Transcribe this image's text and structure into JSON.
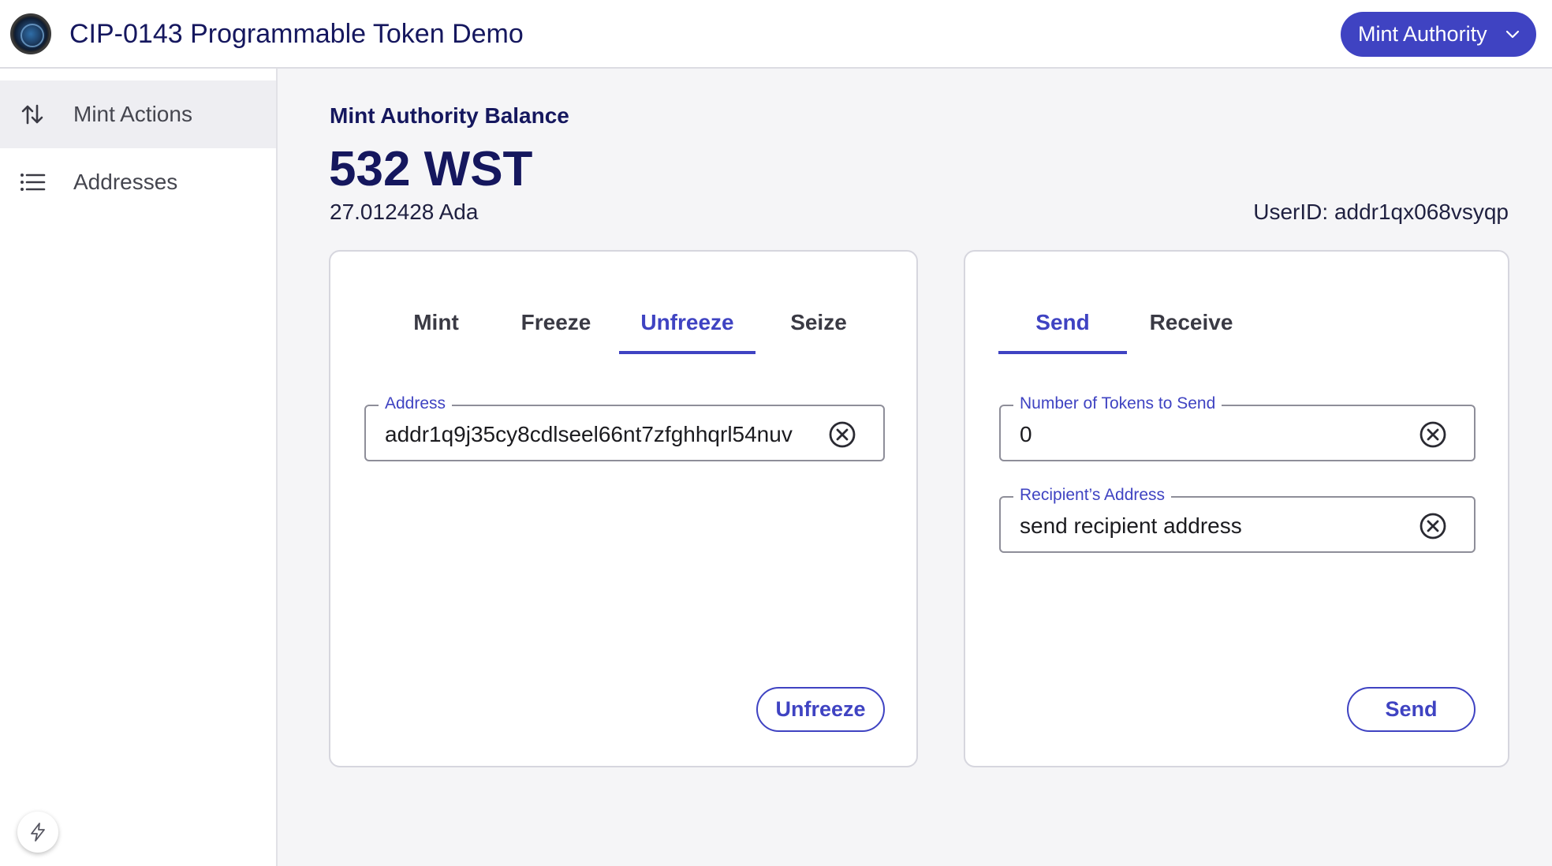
{
  "header": {
    "title": "CIP-0143 Programmable Token Demo",
    "role_selector": "Mint Authority"
  },
  "sidebar": {
    "items": [
      {
        "label": "Mint Actions",
        "icon": "swap-vertical-icon",
        "active": true
      },
      {
        "label": "Addresses",
        "icon": "list-icon",
        "active": false
      }
    ]
  },
  "balance": {
    "label": "Mint Authority Balance",
    "tokens": "532 WST",
    "ada": "27.012428 Ada",
    "user_id": "UserID: addr1qx068vsyqp"
  },
  "actions_card": {
    "tabs": [
      "Mint",
      "Freeze",
      "Unfreeze",
      "Seize"
    ],
    "selected_tab": "Unfreeze",
    "address_field": {
      "label": "Address",
      "value": "addr1q9j35cy8cdlseel66nt7zfghhqrl54nuv"
    },
    "submit_label": "Unfreeze"
  },
  "transfer_card": {
    "tabs": [
      "Send",
      "Receive"
    ],
    "selected_tab": "Send",
    "tokens_field": {
      "label": "Number of Tokens to Send",
      "value": "0"
    },
    "recipient_field": {
      "label": "Recipient’s Address",
      "value": "send recipient address"
    },
    "submit_label": "Send"
  },
  "colors": {
    "accent": "#3f43c2",
    "title": "#15175e"
  }
}
